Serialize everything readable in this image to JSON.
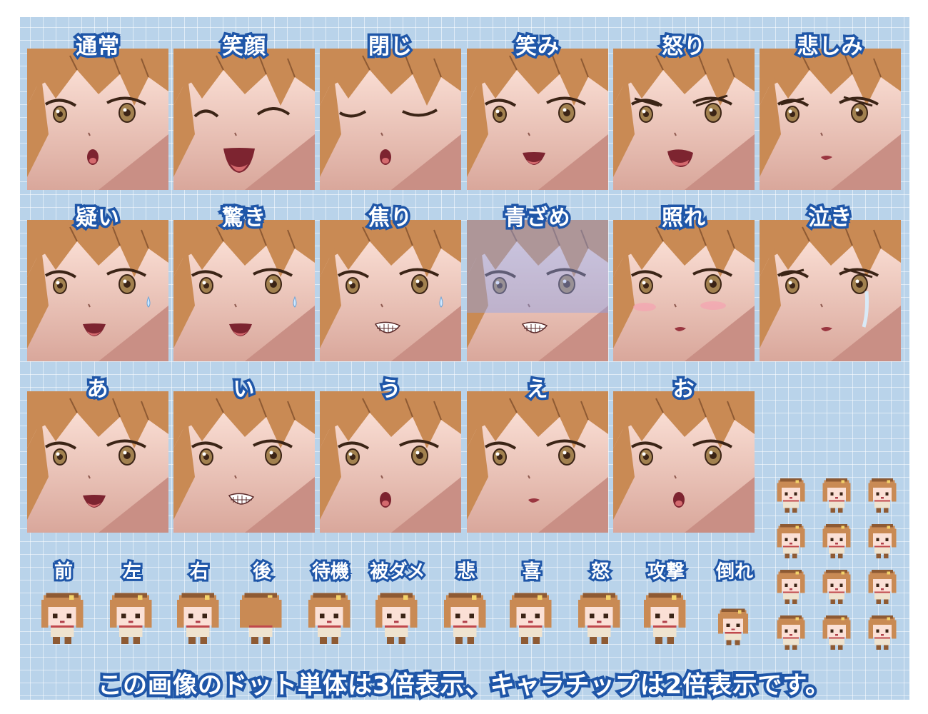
{
  "expressions": [
    {
      "label": "通常",
      "eyes": "open",
      "mouth": "open-o",
      "extra": "none"
    },
    {
      "label": "笑顔",
      "eyes": "closed-happy",
      "mouth": "big-smile",
      "extra": "none"
    },
    {
      "label": "閉じ",
      "eyes": "closed",
      "mouth": "open-o",
      "extra": "none"
    },
    {
      "label": "笑み",
      "eyes": "open",
      "mouth": "smile",
      "extra": "none"
    },
    {
      "label": "怒り",
      "eyes": "angry",
      "mouth": "open-wide",
      "extra": "none"
    },
    {
      "label": "悲しみ",
      "eyes": "sad",
      "mouth": "small",
      "extra": "none"
    },
    {
      "label": "疑い",
      "eyes": "open",
      "mouth": "smile",
      "extra": "sweat"
    },
    {
      "label": "驚き",
      "eyes": "open",
      "mouth": "smile",
      "extra": "sweat"
    },
    {
      "label": "焦り",
      "eyes": "open",
      "mouth": "teeth",
      "extra": "sweat"
    },
    {
      "label": "青ざめ",
      "eyes": "open",
      "mouth": "teeth",
      "extra": "pale"
    },
    {
      "label": "照れ",
      "eyes": "open",
      "mouth": "small",
      "extra": "blush"
    },
    {
      "label": "泣き",
      "eyes": "sad",
      "mouth": "small",
      "extra": "tears"
    },
    {
      "label": "あ",
      "eyes": "open",
      "mouth": "smile",
      "extra": "none"
    },
    {
      "label": "い",
      "eyes": "open",
      "mouth": "teeth",
      "extra": "none"
    },
    {
      "label": "う",
      "eyes": "open",
      "mouth": "open-o",
      "extra": "none"
    },
    {
      "label": "え",
      "eyes": "open",
      "mouth": "small",
      "extra": "none"
    },
    {
      "label": "お",
      "eyes": "open",
      "mouth": "open-o",
      "extra": "none"
    }
  ],
  "poses": [
    {
      "label": "前",
      "icon": "pixel-front-icon"
    },
    {
      "label": "左",
      "icon": "pixel-left-icon"
    },
    {
      "label": "右",
      "icon": "pixel-right-icon"
    },
    {
      "label": "後",
      "icon": "pixel-back-icon"
    },
    {
      "label": "待機",
      "icon": "pixel-idle-icon"
    },
    {
      "label": "被ダメ",
      "icon": "pixel-damage-icon"
    },
    {
      "label": "悲",
      "icon": "pixel-sad-icon"
    },
    {
      "label": "喜",
      "icon": "pixel-joy-icon"
    },
    {
      "label": "怒",
      "icon": "pixel-angry-icon"
    },
    {
      "label": "攻撃",
      "icon": "pixel-attack-icon"
    },
    {
      "label": "倒れ",
      "icon": "pixel-down-icon"
    }
  ],
  "charachips": [
    "down-1",
    "down-2",
    "down-3",
    "left-1",
    "left-2",
    "left-3",
    "right-1",
    "right-2",
    "right-3",
    "up-1",
    "up-2",
    "up-3"
  ],
  "caption": "この画像のドット単体は3倍表示、キャラチップは2倍表示です。",
  "colors": {
    "background": "#b9d3ea",
    "label_outline": "#1f56a8",
    "hair": "#c98a54",
    "hair_dark": "#8e5a33",
    "skin": "#fbe0d6",
    "eye": "#a2814f"
  }
}
